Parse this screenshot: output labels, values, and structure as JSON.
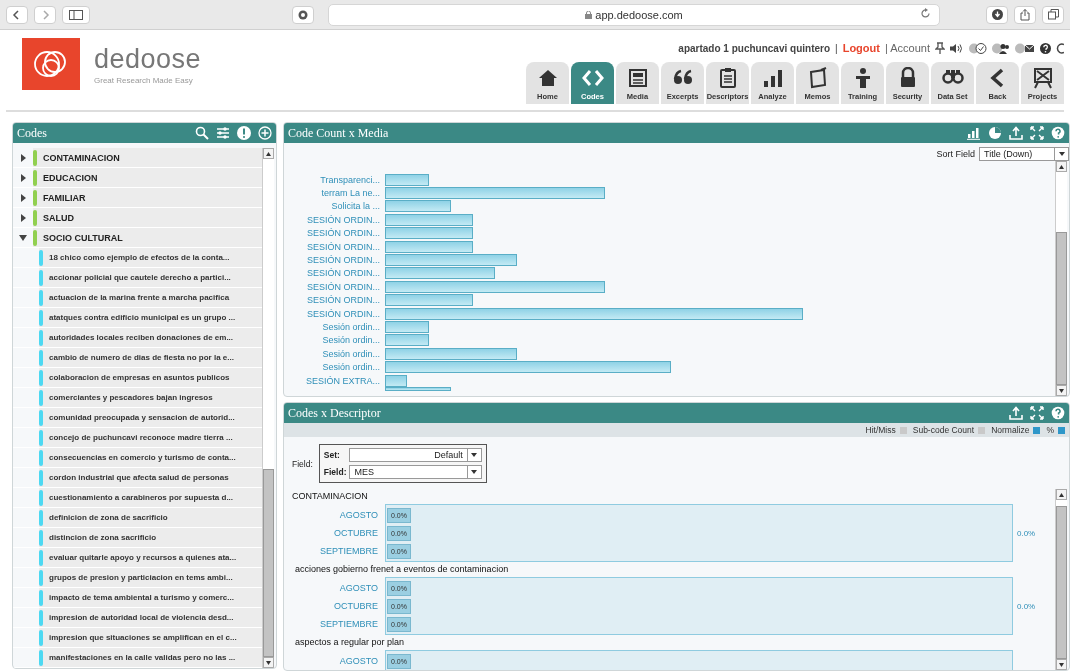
{
  "browser": {
    "url": "app.dedoose.com"
  },
  "header": {
    "logo_name": "dedoose",
    "tagline": "Great Research Made Easy",
    "user": "apartado 1 puchuncavi quintero",
    "separator": "|",
    "logout": "Logout",
    "account": "| Account"
  },
  "nav_tabs": [
    {
      "label": "Home",
      "selected": false
    },
    {
      "label": "Codes",
      "selected": true
    },
    {
      "label": "Media",
      "selected": false
    },
    {
      "label": "Excerpts",
      "selected": false
    },
    {
      "label": "Descriptors",
      "selected": false
    },
    {
      "label": "Analyze",
      "selected": false
    },
    {
      "label": "Memos",
      "selected": false
    },
    {
      "label": "Training",
      "selected": false
    },
    {
      "label": "Security",
      "selected": false
    },
    {
      "label": "Data Set",
      "selected": false
    },
    {
      "label": "Back",
      "selected": false
    },
    {
      "label": "Projects",
      "selected": false
    }
  ],
  "codes_panel": {
    "title": "Codes",
    "tree": [
      {
        "label": "CONTAMINACION",
        "expanded": false,
        "color": "#92d050"
      },
      {
        "label": "EDUCACION",
        "expanded": false,
        "color": "#92d050"
      },
      {
        "label": "FAMILIAR",
        "expanded": false,
        "color": "#92d050"
      },
      {
        "label": "SALUD",
        "expanded": false,
        "color": "#92d050"
      },
      {
        "label": "SOCIO CULTURAL",
        "expanded": true,
        "color": "#92d050",
        "children": [
          {
            "label": "18 chico como ejemplo de efectos de la conta...",
            "color": "#4dd9f2"
          },
          {
            "label": "accionar policial que cautele derecho a partici...",
            "color": "#4dd9f2"
          },
          {
            "label": "actuacion de la marina frente a marcha pacifica",
            "color": "#4dd9f2"
          },
          {
            "label": "atatques contra edificio municipal es un grupo ...",
            "color": "#4dd9f2"
          },
          {
            "label": "autoridades locales reciben donaciones de em...",
            "color": "#4dd9f2"
          },
          {
            "label": "cambio de numero de dias de fiesta no por la e...",
            "color": "#4dd9f2"
          },
          {
            "label": "colaboracion de empresas en asuntos publicos",
            "color": "#4dd9f2"
          },
          {
            "label": "comerciantes y pescadores bajan ingresos",
            "color": "#4dd9f2"
          },
          {
            "label": "comunidad preocupada y sensacion de autorid...",
            "color": "#4dd9f2"
          },
          {
            "label": "concejo de puchuncavi reconoce madre tierra ...",
            "color": "#4dd9f2"
          },
          {
            "label": "consecuencias en comercio y turismo de conta...",
            "color": "#4dd9f2"
          },
          {
            "label": "cordon industrial que afecta salud de personas",
            "color": "#4dd9f2"
          },
          {
            "label": "cuestionamiento a carabineros por supuesta d...",
            "color": "#4dd9f2"
          },
          {
            "label": "definicion de zona de sacrificio",
            "color": "#4dd9f2"
          },
          {
            "label": "distincion de zona sacrificio",
            "color": "#4dd9f2"
          },
          {
            "label": "evaluar quitarle apoyo y recursos a quienes ata...",
            "color": "#4dd9f2"
          },
          {
            "label": "grupos de presion y particiacion en tems ambi...",
            "color": "#4dd9f2"
          },
          {
            "label": "impacto de tema ambiental a turismo y comerc...",
            "color": "#4dd9f2"
          },
          {
            "label": "impresion de autoridad local de violencia desd...",
            "color": "#4dd9f2"
          },
          {
            "label": "impresion que situaciones se amplifican en el c...",
            "color": "#4dd9f2"
          },
          {
            "label": "manifestaciones en la calle validas pero no las ...",
            "color": "#4dd9f2"
          }
        ]
      }
    ]
  },
  "media_panel": {
    "title": "Code Count x Media",
    "sort_label": "Sort Field",
    "sort_value": "Title (Down)",
    "bars": [
      {
        "label": "Transparenci..."
      },
      {
        "label": "terram La ne..."
      },
      {
        "label": "Solicita la ..."
      },
      {
        "label": "SESIÓN ORDIN..."
      },
      {
        "label": "SESIÓN ORDIN..."
      },
      {
        "label": "SESIÓN ORDIN..."
      },
      {
        "label": "SESIÓN ORDIN..."
      },
      {
        "label": "SESIÓN ORDIN..."
      },
      {
        "label": "SESIÓN ORDIN..."
      },
      {
        "label": "SESIÓN ORDIN..."
      },
      {
        "label": "SESIÓN ORDIN..."
      },
      {
        "label": "Sesión ordin..."
      },
      {
        "label": "Sesión ordin..."
      },
      {
        "label": "Sesión ordin..."
      },
      {
        "label": "Sesión ordin..."
      },
      {
        "label": "SESIÓN EXTRA..."
      }
    ]
  },
  "descriptor_panel": {
    "title": "Codes x Descriptor",
    "options": [
      {
        "label": "Hit/Miss",
        "checked": false
      },
      {
        "label": "Sub-code Count",
        "checked": false
      },
      {
        "label": "Normalize",
        "checked": true
      },
      {
        "label": "%",
        "checked": true
      }
    ],
    "field_label": "Field:",
    "set_label": "Set:",
    "set_value": "Default",
    "inner_field_label": "Field:",
    "field_value": "MES",
    "groups": [
      {
        "title": "CONTAMINACION",
        "total": "0.0%",
        "rows": [
          {
            "label": "AGOSTO",
            "value": "0.0%"
          },
          {
            "label": "OCTUBRE",
            "value": "0.0%"
          },
          {
            "label": "SEPTIEMBRE",
            "value": "0.0%"
          }
        ]
      },
      {
        "title": "acciones gobierno frenet a eventos de contaminacion",
        "total": "0.0%",
        "rows": [
          {
            "label": "AGOSTO",
            "value": "0.0%"
          },
          {
            "label": "OCTUBRE",
            "value": "0.0%"
          },
          {
            "label": "SEPTIEMBRE",
            "value": "0.0%"
          }
        ]
      },
      {
        "title": "aspectos a regular por plan",
        "rows": [
          {
            "label": "AGOSTO",
            "value": "0.0%"
          }
        ]
      }
    ]
  }
}
